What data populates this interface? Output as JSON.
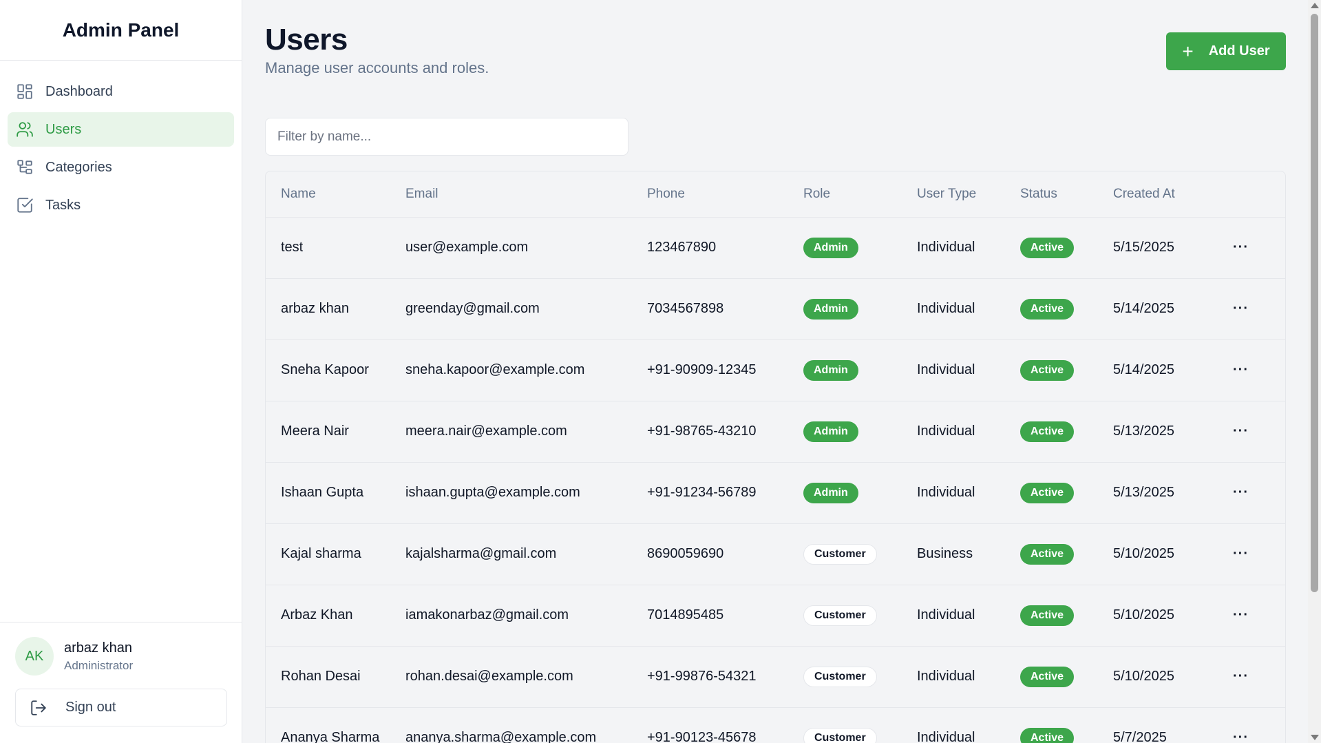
{
  "app": {
    "title": "Admin Panel"
  },
  "sidebar": {
    "items": [
      {
        "label": "Dashboard",
        "icon": "dashboard-icon",
        "active": false
      },
      {
        "label": "Users",
        "icon": "users-icon",
        "active": true
      },
      {
        "label": "Categories",
        "icon": "categories-icon",
        "active": false
      },
      {
        "label": "Tasks",
        "icon": "tasks-icon",
        "active": false
      }
    ],
    "user": {
      "initials": "AK",
      "name": "arbaz khan",
      "role": "Administrator"
    },
    "signout_label": "Sign out"
  },
  "header": {
    "title": "Users",
    "subtitle": "Manage user accounts and roles.",
    "add_button_label": "Add User"
  },
  "filter": {
    "placeholder": "Filter by name...",
    "value": ""
  },
  "table": {
    "columns": [
      "Name",
      "Email",
      "Phone",
      "Role",
      "User Type",
      "Status",
      "Created At"
    ],
    "rows": [
      {
        "name": "test",
        "email": "user@example.com",
        "phone": "123467890",
        "role": "Admin",
        "type": "Individual",
        "status": "Active",
        "created": "5/15/2025"
      },
      {
        "name": "arbaz khan",
        "email": "greenday@gmail.com",
        "phone": "7034567898",
        "role": "Admin",
        "type": "Individual",
        "status": "Active",
        "created": "5/14/2025"
      },
      {
        "name": "Sneha Kapoor",
        "email": "sneha.kapoor@example.com",
        "phone": "+91-90909-12345",
        "role": "Admin",
        "type": "Individual",
        "status": "Active",
        "created": "5/14/2025"
      },
      {
        "name": "Meera Nair",
        "email": "meera.nair@example.com",
        "phone": "+91-98765-43210",
        "role": "Admin",
        "type": "Individual",
        "status": "Active",
        "created": "5/13/2025"
      },
      {
        "name": "Ishaan Gupta",
        "email": "ishaan.gupta@example.com",
        "phone": "+91-91234-56789",
        "role": "Admin",
        "type": "Individual",
        "status": "Active",
        "created": "5/13/2025"
      },
      {
        "name": "Kajal sharma",
        "email": "kajalsharma@gmail.com",
        "phone": "8690059690",
        "role": "Customer",
        "type": "Business",
        "status": "Active",
        "created": "5/10/2025"
      },
      {
        "name": "Arbaz Khan",
        "email": "iamakonarbaz@gmail.com",
        "phone": "7014895485",
        "role": "Customer",
        "type": "Individual",
        "status": "Active",
        "created": "5/10/2025"
      },
      {
        "name": "Rohan Desai",
        "email": "rohan.desai@example.com",
        "phone": "+91-99876-54321",
        "role": "Customer",
        "type": "Individual",
        "status": "Active",
        "created": "5/10/2025"
      },
      {
        "name": "Ananya Sharma",
        "email": "ananya.sharma@example.com",
        "phone": "+91-90123-45678",
        "role": "Customer",
        "type": "Individual",
        "status": "Active",
        "created": "5/7/2025"
      }
    ],
    "row_action_icon": "more-horizontal-icon"
  },
  "colors": {
    "accent": "#3da64b",
    "accent_light": "#e8f5e9",
    "text_muted": "#64748b"
  }
}
